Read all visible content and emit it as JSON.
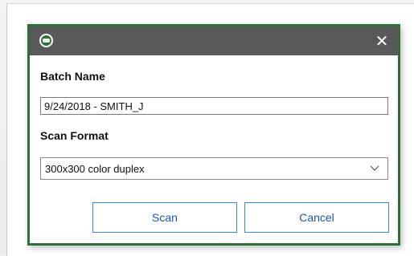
{
  "dialog": {
    "icon": "app-logo-icon",
    "close_icon": "close-icon",
    "batch_name_label": "Batch Name",
    "batch_name_value": "9/24/2018 - SMITH_J",
    "scan_format_label": "Scan Format",
    "scan_format_value": "300x300 color duplex",
    "scan_button_label": "Scan",
    "cancel_button_label": "Cancel",
    "close_glyph": "✕"
  },
  "colors": {
    "titlebar": "#595959",
    "border": "#2f6f3a",
    "button_border": "#3f86d6",
    "button_text": "#1a57a8"
  }
}
